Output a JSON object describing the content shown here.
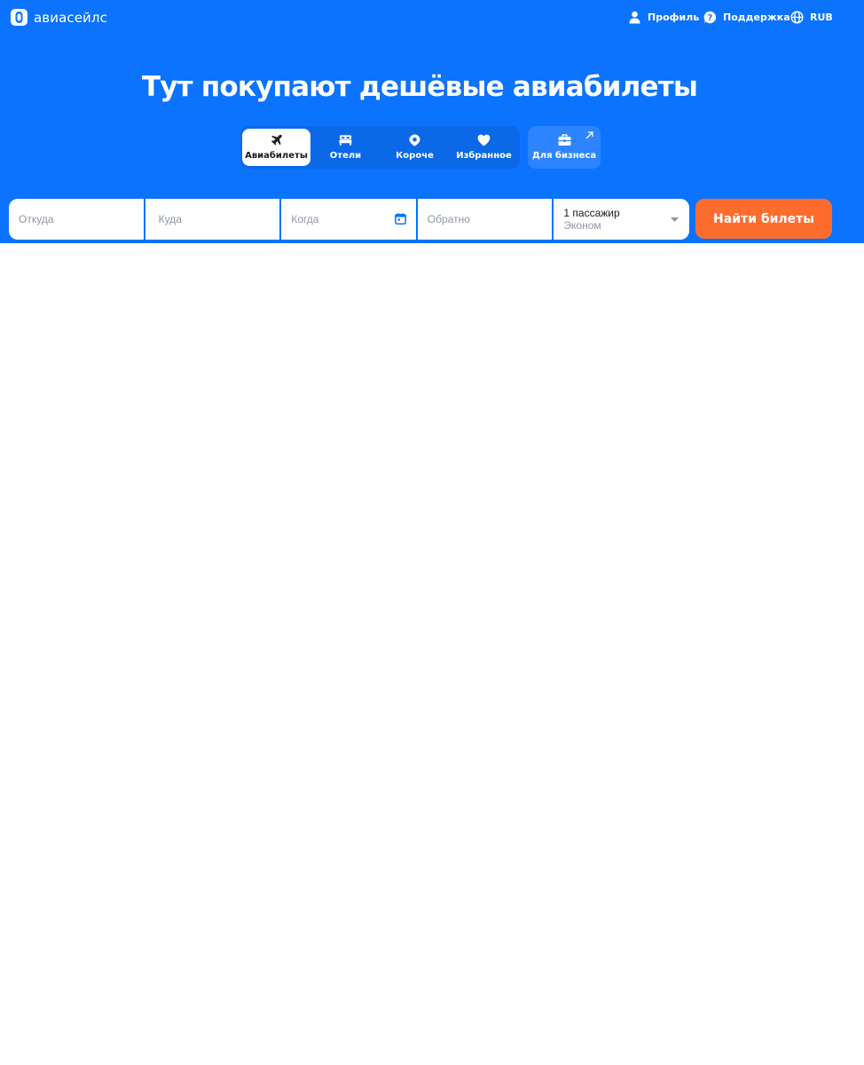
{
  "header": {
    "logo_text": "авиасейлс",
    "nav": [
      {
        "label": "Профиль",
        "icon": "user-icon"
      },
      {
        "label": "Поддержка",
        "icon": "help-icon"
      },
      {
        "label": "RUB",
        "icon": "globe-icon"
      }
    ]
  },
  "hero": {
    "title": "Тут покупают дешёвые авиабилеты"
  },
  "tabs": [
    {
      "label": "Авиабилеты",
      "icon": "plane-icon",
      "active": true
    },
    {
      "label": "Отели",
      "icon": "bed-icon",
      "active": false
    },
    {
      "label": "Короче",
      "icon": "location-icon",
      "active": false
    },
    {
      "label": "Избранное",
      "icon": "heart-icon",
      "active": false
    }
  ],
  "business_tab": {
    "label": "Для бизнеса",
    "icon": "briefcase-icon",
    "external_icon": "external-arrow-icon"
  },
  "search": {
    "from_placeholder": "Откуда",
    "to_placeholder": "Куда",
    "when_placeholder": "Когда",
    "back_placeholder": "Обратно",
    "passengers": "1 пассажир",
    "cabin_class": "Эконом",
    "submit_label": "Найти билеты"
  },
  "colors": {
    "brand_blue": "#0c73fe",
    "accent_orange": "#ff6d2e"
  }
}
